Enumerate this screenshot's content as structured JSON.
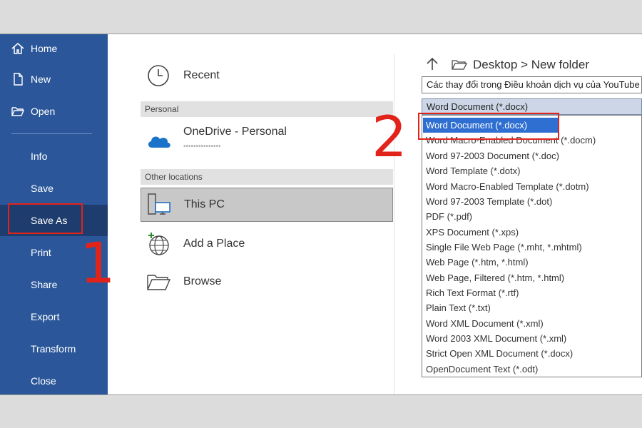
{
  "sidebar": {
    "items": [
      {
        "label": "Home",
        "icon": "home-icon"
      },
      {
        "label": "New",
        "icon": "new-document-icon"
      },
      {
        "label": "Open",
        "icon": "open-folder-icon"
      },
      {
        "label": "Info"
      },
      {
        "label": "Save"
      },
      {
        "label": "Save As"
      },
      {
        "label": "Print"
      },
      {
        "label": "Share"
      },
      {
        "label": "Export"
      },
      {
        "label": "Transform"
      },
      {
        "label": "Close"
      }
    ]
  },
  "annotations": {
    "step1": "1",
    "step2": "2"
  },
  "locations": {
    "recent": "Recent",
    "group_personal": "Personal",
    "onedrive": "OneDrive - Personal",
    "onedrive_account": "•••••••••••••••",
    "group_other": "Other locations",
    "this_pc": "This PC",
    "add_place": "Add a Place",
    "browse": "Browse"
  },
  "save_panel": {
    "path": "Desktop > New folder",
    "file_name": "Các thay đổi trong Điều khoản dịch vụ của YouTube",
    "file_type": "Word Document (*.docx)",
    "file_types": [
      "Word Document (*.docx)",
      "Word Macro-Enabled Document (*.docm)",
      "Word 97-2003 Document (*.doc)",
      "Word Template (*.dotx)",
      "Word Macro-Enabled Template (*.dotm)",
      "Word 97-2003 Template (*.dot)",
      "PDF (*.pdf)",
      "XPS Document (*.xps)",
      "Single File Web Page (*.mht, *.mhtml)",
      "Web Page (*.htm, *.html)",
      "Web Page, Filtered (*.htm, *.html)",
      "Rich Text Format (*.rtf)",
      "Plain Text (*.txt)",
      "Word XML Document (*.xml)",
      "Word 2003 XML Document (*.xml)",
      "Strict Open XML Document (*.docx)",
      "OpenDocument Text (*.odt)"
    ],
    "selected_index": 0
  },
  "colors": {
    "sidebar": "#2b579a",
    "sidebar_active": "#1e3d6e",
    "highlight": "#2f6fd2",
    "annotation_red": "#e2231a"
  }
}
